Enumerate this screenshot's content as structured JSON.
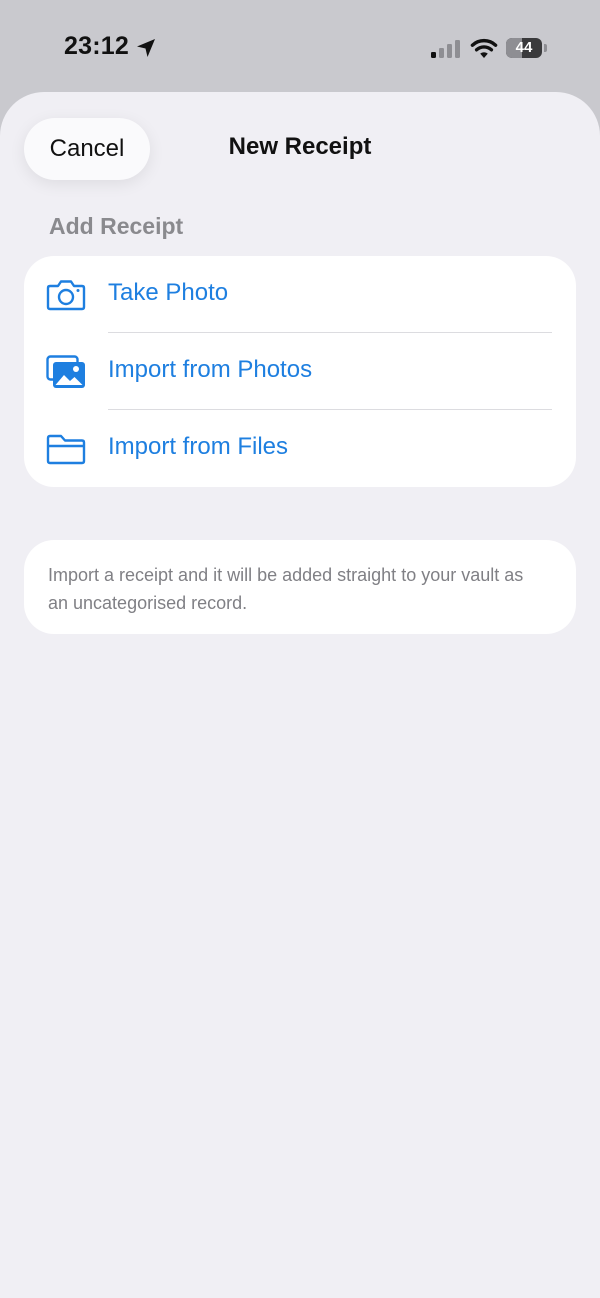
{
  "status_bar": {
    "time": "23:12",
    "battery_level": "44",
    "battery_fraction": 0.44,
    "icons": [
      "location-arrow-icon",
      "cellular-signal-icon",
      "wifi-icon",
      "battery-icon"
    ]
  },
  "sheet": {
    "title": "New Receipt",
    "cancel_label": "Cancel",
    "section_header": "Add Receipt",
    "options": [
      {
        "label": "Take Photo",
        "icon": "camera-icon"
      },
      {
        "label": "Import from Photos",
        "icon": "photos-icon"
      },
      {
        "label": "Import from Files",
        "icon": "folder-icon"
      }
    ],
    "info_text": "Import a receipt and it will be added straight to your vault as an uncategorised record."
  },
  "colors": {
    "accent": "#1e7fe0",
    "sheet_background": "#f0eff4",
    "card_background": "#ffffff",
    "secondary_text": "#808085"
  }
}
